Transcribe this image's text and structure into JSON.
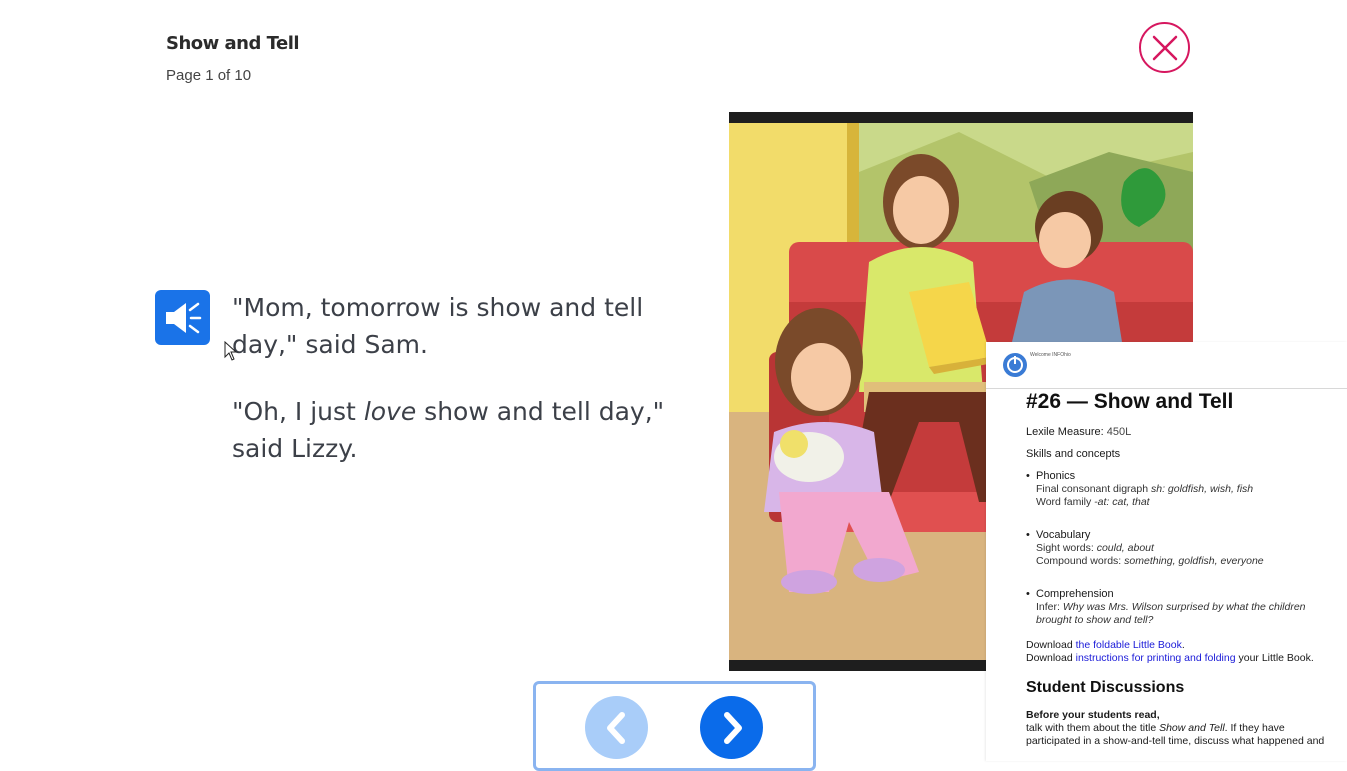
{
  "header": {
    "book_title": "Show and Tell",
    "page_indicator": "Page 1 of 10"
  },
  "icons": {
    "close": "close-icon",
    "audio": "speaker-icon",
    "prev": "chevron-left-icon",
    "next": "chevron-right-icon",
    "power": "power-icon"
  },
  "story": {
    "line1": "\"Mom, tomorrow is show and tell day,\" said Sam.",
    "line2_before": "\"Oh, I just ",
    "line2_em": "love",
    "line2_after": " show and tell day,\" said Lizzy."
  },
  "popup": {
    "welcome": "Welcome INFOhio",
    "title": "#26 — Show and Tell",
    "lexile_label": "Lexile Measure:",
    "lexile_value": "450L",
    "skills_heading": "Skills and concepts",
    "phonics_title": "Phonics",
    "phonics_line1_label": "Final consonant digraph ",
    "phonics_line1_examples": "sh: goldfish, wish, fish",
    "phonics_line2_label": "Word family ",
    "phonics_line2_examples": "-at: cat, that",
    "vocab_title": "Vocabulary",
    "vocab_line1_label": "Sight words: ",
    "vocab_line1_examples": "could, about",
    "vocab_line2_label": "Compound words: ",
    "vocab_line2_examples": "something, goldfish, everyone",
    "comp_title": "Comprehension",
    "comp_label": "Infer: ",
    "comp_question": "Why was Mrs. Wilson surprised by what the children brought to show and tell?",
    "download1_prefix": "Download ",
    "download1_link": "the foldable Little Book",
    "download1_suffix": ".",
    "download2_prefix": "Download ",
    "download2_link": "instructions for printing and folding",
    "download2_suffix": " your Little Book.",
    "discussions_heading": "Student Discussions",
    "before_read": "Before your students read,",
    "before_read_text_1": "talk with them about the title ",
    "before_read_title": "Show and Tell",
    "before_read_text_2": ". If they have participated in a show-and-tell time, discuss what happened and"
  },
  "colors": {
    "accent_blue": "#1a73e8",
    "close_pink": "#d6175f",
    "nav_next": "#0a6bea",
    "nav_prev_disabled": "#a9cdf9",
    "nav_border": "#8ab4f0",
    "link": "#1a1ad8"
  }
}
